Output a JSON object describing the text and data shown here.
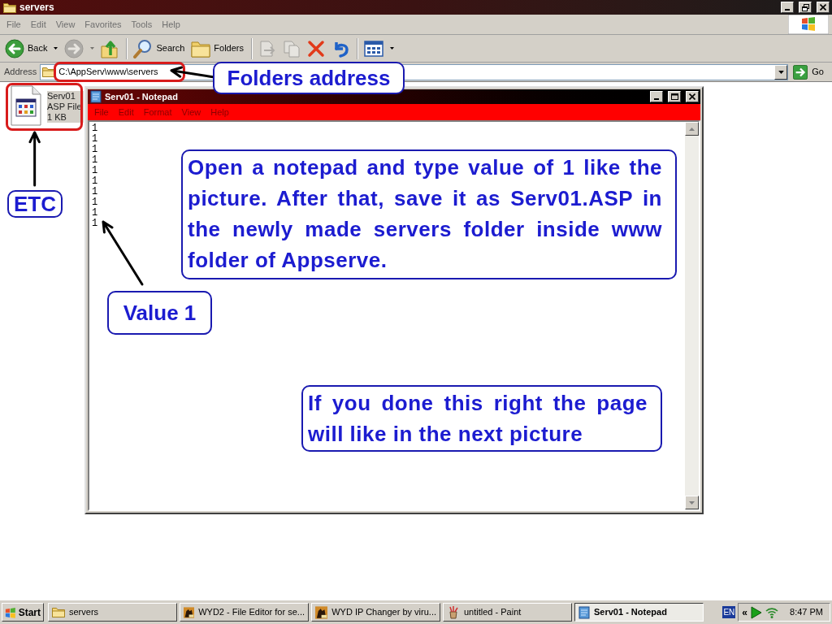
{
  "window": {
    "title": "servers"
  },
  "menu_bar": [
    "File",
    "Edit",
    "View",
    "Favorites",
    "Tools",
    "Help"
  ],
  "toolbar_groups": [
    [
      {
        "kind": "back",
        "label": "Back",
        "disabled": false
      },
      {
        "kind": "forward",
        "disabled": true
      },
      {
        "kind": "up",
        "disabled": false
      }
    ],
    [
      {
        "kind": "search",
        "label": "Search",
        "disabled": false
      },
      {
        "kind": "folders",
        "label": "Folders",
        "disabled": false
      }
    ],
    [
      {
        "kind": "move",
        "disabled": true
      },
      {
        "kind": "copy",
        "disabled": true
      },
      {
        "kind": "delete",
        "disabled": false
      },
      {
        "kind": "undo",
        "disabled": false
      }
    ],
    [
      {
        "kind": "views",
        "disabled": false
      }
    ]
  ],
  "address_bar": {
    "label": "Address",
    "value": "C:\\AppServ\\www\\servers",
    "go": "Go"
  },
  "files": [
    {
      "name": "Serv01",
      "type": "ASP File",
      "size": "1 KB",
      "selected": true
    }
  ],
  "notepad": {
    "title": "Serv01 - Notepad",
    "menu": [
      "File",
      "Edit",
      "Format",
      "View",
      "Help"
    ],
    "lines": [
      "1",
      "1",
      "1",
      "1",
      "1",
      "1",
      "1",
      "1",
      "1",
      "1"
    ]
  },
  "annotations": [
    {
      "kind": "highlight"
    },
    {
      "kind": "arrow"
    },
    {
      "kind": "callout",
      "text": "Folders address"
    },
    {
      "kind": "highlight"
    },
    {
      "kind": "arrow"
    },
    {
      "kind": "callout",
      "text": "ETC"
    },
    {
      "kind": "callout",
      "text": "Open a notepad and type value of 1 like the picture. After that, save it as Serv01.ASP in the newly made servers folder inside www folder of Appserve."
    },
    {
      "kind": "arrow"
    },
    {
      "kind": "callout",
      "text": "Value 1"
    },
    {
      "kind": "callout",
      "text": "If you done this right the page will like in the next picture"
    }
  ],
  "taskbar": {
    "start": "Start",
    "tasks": [
      {
        "kind": "folder",
        "label": "servers",
        "selected": false
      },
      {
        "kind": "game",
        "label": "WYD2 - File Editor for se...",
        "selected": false
      },
      {
        "kind": "game",
        "label": "WYD IP Changer by viru...",
        "selected": false
      },
      {
        "kind": "paint",
        "label": "untitled - Paint",
        "selected": false
      },
      {
        "kind": "notepad",
        "label": "Serv01 - Notepad",
        "selected": true
      }
    ],
    "tray": {
      "language": "EN",
      "expand": "«",
      "clock": "8:47 PM"
    }
  }
}
